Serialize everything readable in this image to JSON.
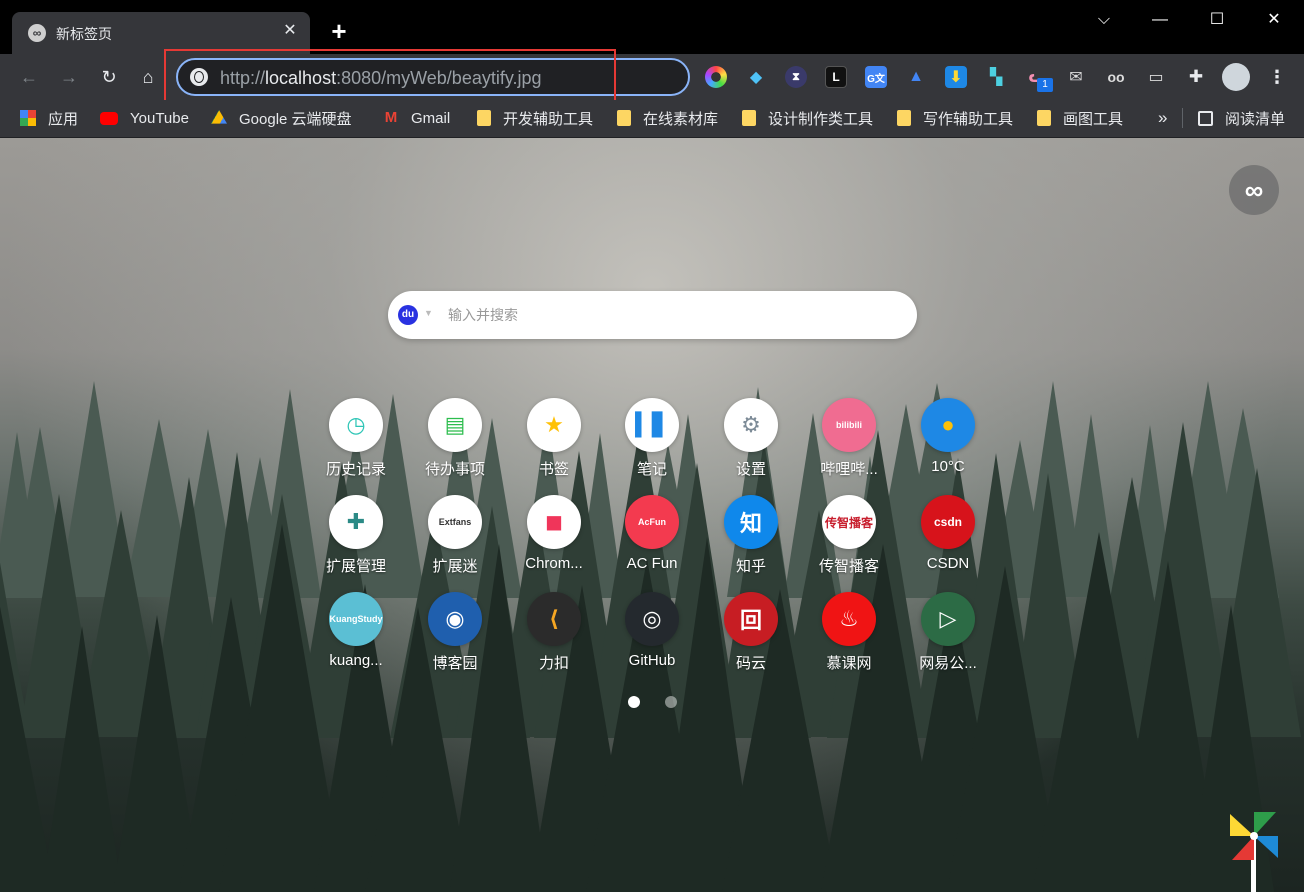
{
  "tab": {
    "title": "新标签页"
  },
  "window_controls": {
    "dropdown": "⌵",
    "minimize": "—",
    "maximize": "☐",
    "close": "✕"
  },
  "toolbar": {
    "url_scheme": "http://",
    "url_host": "localhost",
    "url_rest": ":8080/myWeb/beaytify.jpg"
  },
  "extensions": [
    "color-picker-icon",
    "diamond-icon",
    "hourglass-icon",
    "l-icon",
    "translate-icon",
    "graduation-icon",
    "download-icon",
    "grid-icon",
    "cat-icon",
    "mail-icon",
    "mask-icon",
    "screen-icon",
    "puzzle-icon"
  ],
  "extension_badge": "1",
  "bookmarks": {
    "items": [
      {
        "label": "应用",
        "icon": "apps-icon"
      },
      {
        "label": "YouTube",
        "icon": "youtube-icon"
      },
      {
        "label": "Google 云端硬盘",
        "icon": "drive-icon"
      },
      {
        "label": "Gmail",
        "icon": "gmail-icon"
      },
      {
        "label": "开发辅助工具",
        "icon": "folder-icon"
      },
      {
        "label": "在线素材库",
        "icon": "folder-icon"
      },
      {
        "label": "设计制作类工具",
        "icon": "folder-icon"
      },
      {
        "label": "写作辅助工具",
        "icon": "folder-icon"
      },
      {
        "label": "画图工具",
        "icon": "folder-icon"
      }
    ],
    "overflow": "»",
    "reading_list": "阅读清单"
  },
  "page": {
    "logo_symbol": "∞",
    "search": {
      "placeholder": "输入并搜索",
      "engine_icon": "baidu-icon",
      "caret": "▼"
    },
    "apps": [
      {
        "label": "历史记录",
        "icon": "clock-icon",
        "bg": "#ffffff",
        "fg": "#2ec5b6",
        "glyph": "◷"
      },
      {
        "label": "待办事项",
        "icon": "todo-icon",
        "bg": "#ffffff",
        "fg": "#2dbd4e",
        "glyph": "▤"
      },
      {
        "label": "书签",
        "icon": "star-icon",
        "bg": "#ffffff",
        "fg": "#ffc107",
        "glyph": "★"
      },
      {
        "label": "笔记",
        "icon": "notebook-icon",
        "bg": "#ffffff",
        "fg": "#1e88e5",
        "glyph": "▍▋"
      },
      {
        "label": "设置",
        "icon": "gear-icon",
        "bg": "#ffffff",
        "fg": "#7d8b97",
        "glyph": "⚙"
      },
      {
        "label": "哔哩哔...",
        "icon": "bilibili-icon",
        "bg": "#f06c91",
        "fg": "#ffffff",
        "glyph": "bilibili"
      },
      {
        "label": "10°C",
        "icon": "weather-icon",
        "bg": "#1e88e5",
        "fg": "#ffc107",
        "glyph": "●"
      },
      {
        "label": "扩展管理",
        "icon": "puzzle-icon",
        "bg": "#ffffff",
        "fg": "#2b8a86",
        "glyph": "✚"
      },
      {
        "label": "扩展迷",
        "icon": "extfans-icon",
        "bg": "#ffffff",
        "fg": "#333333",
        "glyph": "Extfans"
      },
      {
        "label": "Chrom...",
        "icon": "shopping-bag-icon",
        "bg": "#ffffff",
        "fg": "#f0355a",
        "glyph": "◼"
      },
      {
        "label": "AC Fun",
        "icon": "acfun-icon",
        "bg": "#f33a4f",
        "fg": "#ffffff",
        "glyph": "AcFun"
      },
      {
        "label": "知乎",
        "icon": "zhihu-icon",
        "bg": "#0f88eb",
        "fg": "#ffffff",
        "glyph": "知"
      },
      {
        "label": "传智播客",
        "icon": "itcast-icon",
        "bg": "#ffffff",
        "fg": "#c8202f",
        "glyph": "传智播客"
      },
      {
        "label": "CSDN",
        "icon": "csdn-icon",
        "bg": "#d7131b",
        "fg": "#ffffff",
        "glyph": "csdn"
      },
      {
        "label": "kuang...",
        "icon": "kuangstudy-icon",
        "bg": "#5bbfd4",
        "fg": "#ffffff",
        "glyph": "KuangStudy"
      },
      {
        "label": "博客园",
        "icon": "cnblogs-icon",
        "bg": "#1f5fae",
        "fg": "#ffffff",
        "glyph": "◉"
      },
      {
        "label": "力扣",
        "icon": "leetcode-icon",
        "bg": "#2b2b2b",
        "fg": "#f5a623",
        "glyph": "⟨"
      },
      {
        "label": "GitHub",
        "icon": "github-icon",
        "bg": "#24292e",
        "fg": "#ffffff",
        "glyph": "◎"
      },
      {
        "label": "码云",
        "icon": "gitee-icon",
        "bg": "#c71d23",
        "fg": "#ffffff",
        "glyph": "回"
      },
      {
        "label": "慕课网",
        "icon": "imooc-icon",
        "bg": "#f01414",
        "fg": "#ffffff",
        "glyph": "♨"
      },
      {
        "label": "网易公...",
        "icon": "play-icon",
        "bg": "#2c6b45",
        "fg": "#ffffff",
        "glyph": "▷"
      }
    ],
    "pages": [
      {
        "active": true
      },
      {
        "active": false
      }
    ]
  }
}
